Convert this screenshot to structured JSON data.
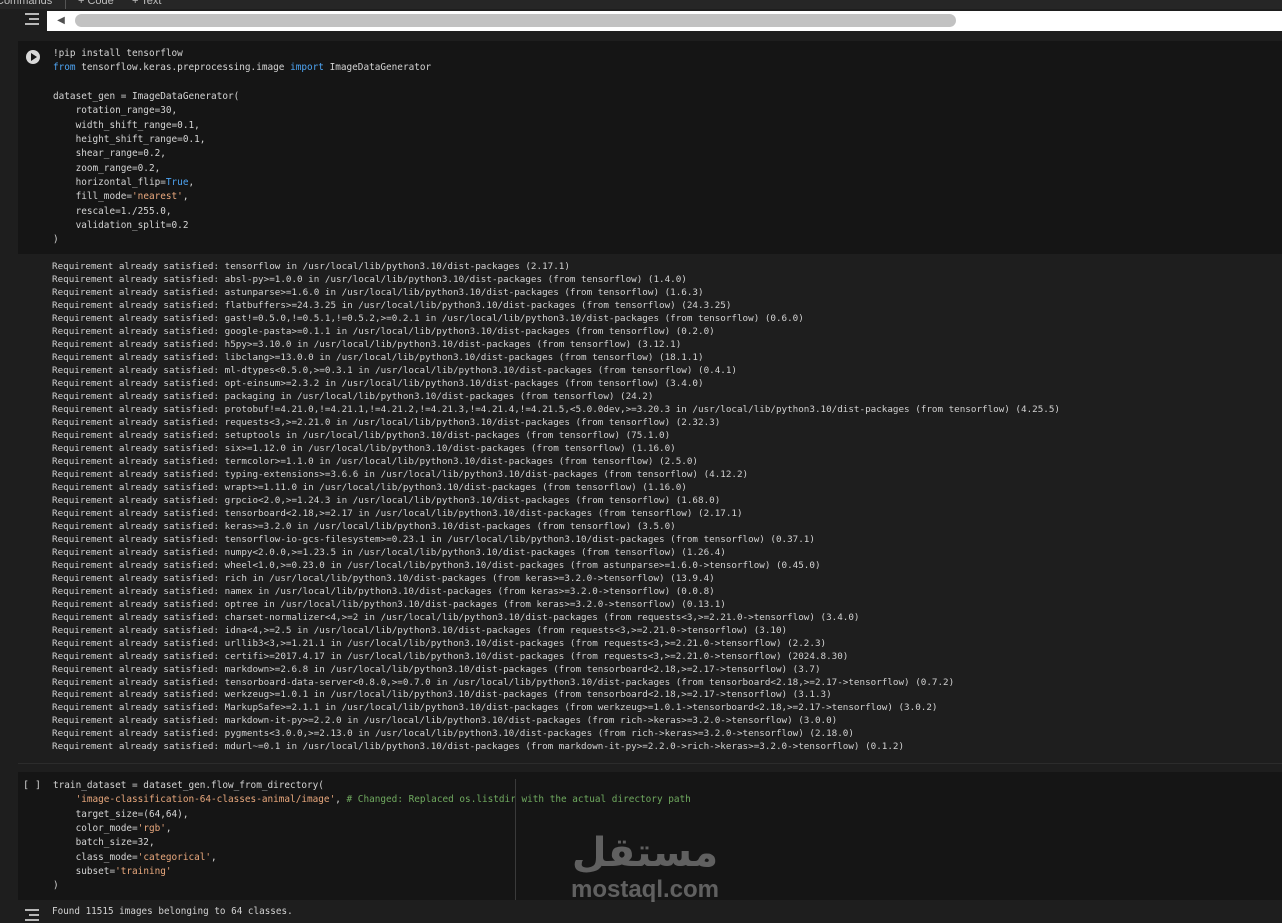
{
  "toolbar": {
    "commands_label": "Commands",
    "add_code_label": "+ Code",
    "add_text_label": "+ Text"
  },
  "cells": [
    {
      "execution_count": "",
      "code_lines": [
        [
          {
            "t": "!pip install tensorflow"
          }
        ],
        [
          {
            "t": "from",
            "c": "kw"
          },
          {
            "t": " tensorflow.keras.preprocessing.image "
          },
          {
            "t": "import",
            "c": "kw"
          },
          {
            "t": " ImageDataGenerator"
          }
        ],
        [
          {
            "t": ""
          }
        ],
        [
          {
            "t": "dataset_gen = ImageDataGenerator("
          }
        ],
        [
          {
            "t": "    rotation_range=30,"
          }
        ],
        [
          {
            "t": "    width_shift_range=0.1,"
          }
        ],
        [
          {
            "t": "    height_shift_range=0.1,"
          }
        ],
        [
          {
            "t": "    shear_range=0.2,"
          }
        ],
        [
          {
            "t": "    zoom_range=0.2,"
          }
        ],
        [
          {
            "t": "    horizontal_flip="
          },
          {
            "t": "True",
            "c": "kw"
          },
          {
            "t": ","
          }
        ],
        [
          {
            "t": "    fill_mode="
          },
          {
            "t": "'nearest'",
            "c": "str"
          },
          {
            "t": ","
          }
        ],
        [
          {
            "t": "    rescale=1./255.0,"
          }
        ],
        [
          {
            "t": "    validation_split=0.2"
          }
        ],
        [
          {
            "t": ")"
          }
        ]
      ],
      "output_lines": [
        "Requirement already satisfied: tensorflow in /usr/local/lib/python3.10/dist-packages (2.17.1)",
        "Requirement already satisfied: absl-py>=1.0.0 in /usr/local/lib/python3.10/dist-packages (from tensorflow) (1.4.0)",
        "Requirement already satisfied: astunparse>=1.6.0 in /usr/local/lib/python3.10/dist-packages (from tensorflow) (1.6.3)",
        "Requirement already satisfied: flatbuffers>=24.3.25 in /usr/local/lib/python3.10/dist-packages (from tensorflow) (24.3.25)",
        "Requirement already satisfied: gast!=0.5.0,!=0.5.1,!=0.5.2,>=0.2.1 in /usr/local/lib/python3.10/dist-packages (from tensorflow) (0.6.0)",
        "Requirement already satisfied: google-pasta>=0.1.1 in /usr/local/lib/python3.10/dist-packages (from tensorflow) (0.2.0)",
        "Requirement already satisfied: h5py>=3.10.0 in /usr/local/lib/python3.10/dist-packages (from tensorflow) (3.12.1)",
        "Requirement already satisfied: libclang>=13.0.0 in /usr/local/lib/python3.10/dist-packages (from tensorflow) (18.1.1)",
        "Requirement already satisfied: ml-dtypes<0.5.0,>=0.3.1 in /usr/local/lib/python3.10/dist-packages (from tensorflow) (0.4.1)",
        "Requirement already satisfied: opt-einsum>=2.3.2 in /usr/local/lib/python3.10/dist-packages (from tensorflow) (3.4.0)",
        "Requirement already satisfied: packaging in /usr/local/lib/python3.10/dist-packages (from tensorflow) (24.2)",
        "Requirement already satisfied: protobuf!=4.21.0,!=4.21.1,!=4.21.2,!=4.21.3,!=4.21.4,!=4.21.5,<5.0.0dev,>=3.20.3 in /usr/local/lib/python3.10/dist-packages (from tensorflow) (4.25.5)",
        "Requirement already satisfied: requests<3,>=2.21.0 in /usr/local/lib/python3.10/dist-packages (from tensorflow) (2.32.3)",
        "Requirement already satisfied: setuptools in /usr/local/lib/python3.10/dist-packages (from tensorflow) (75.1.0)",
        "Requirement already satisfied: six>=1.12.0 in /usr/local/lib/python3.10/dist-packages (from tensorflow) (1.16.0)",
        "Requirement already satisfied: termcolor>=1.1.0 in /usr/local/lib/python3.10/dist-packages (from tensorflow) (2.5.0)",
        "Requirement already satisfied: typing-extensions>=3.6.6 in /usr/local/lib/python3.10/dist-packages (from tensorflow) (4.12.2)",
        "Requirement already satisfied: wrapt>=1.11.0 in /usr/local/lib/python3.10/dist-packages (from tensorflow) (1.16.0)",
        "Requirement already satisfied: grpcio<2.0,>=1.24.3 in /usr/local/lib/python3.10/dist-packages (from tensorflow) (1.68.0)",
        "Requirement already satisfied: tensorboard<2.18,>=2.17 in /usr/local/lib/python3.10/dist-packages (from tensorflow) (2.17.1)",
        "Requirement already satisfied: keras>=3.2.0 in /usr/local/lib/python3.10/dist-packages (from tensorflow) (3.5.0)",
        "Requirement already satisfied: tensorflow-io-gcs-filesystem>=0.23.1 in /usr/local/lib/python3.10/dist-packages (from tensorflow) (0.37.1)",
        "Requirement already satisfied: numpy<2.0.0,>=1.23.5 in /usr/local/lib/python3.10/dist-packages (from tensorflow) (1.26.4)",
        "Requirement already satisfied: wheel<1.0,>=0.23.0 in /usr/local/lib/python3.10/dist-packages (from astunparse>=1.6.0->tensorflow) (0.45.0)",
        "Requirement already satisfied: rich in /usr/local/lib/python3.10/dist-packages (from keras>=3.2.0->tensorflow) (13.9.4)",
        "Requirement already satisfied: namex in /usr/local/lib/python3.10/dist-packages (from keras>=3.2.0->tensorflow) (0.0.8)",
        "Requirement already satisfied: optree in /usr/local/lib/python3.10/dist-packages (from keras>=3.2.0->tensorflow) (0.13.1)",
        "Requirement already satisfied: charset-normalizer<4,>=2 in /usr/local/lib/python3.10/dist-packages (from requests<3,>=2.21.0->tensorflow) (3.4.0)",
        "Requirement already satisfied: idna<4,>=2.5 in /usr/local/lib/python3.10/dist-packages (from requests<3,>=2.21.0->tensorflow) (3.10)",
        "Requirement already satisfied: urllib3<3,>=1.21.1 in /usr/local/lib/python3.10/dist-packages (from requests<3,>=2.21.0->tensorflow) (2.2.3)",
        "Requirement already satisfied: certifi>=2017.4.17 in /usr/local/lib/python3.10/dist-packages (from requests<3,>=2.21.0->tensorflow) (2024.8.30)",
        "Requirement already satisfied: markdown>=2.6.8 in /usr/local/lib/python3.10/dist-packages (from tensorboard<2.18,>=2.17->tensorflow) (3.7)",
        "Requirement already satisfied: tensorboard-data-server<0.8.0,>=0.7.0 in /usr/local/lib/python3.10/dist-packages (from tensorboard<2.18,>=2.17->tensorflow) (0.7.2)",
        "Requirement already satisfied: werkzeug>=1.0.1 in /usr/local/lib/python3.10/dist-packages (from tensorboard<2.18,>=2.17->tensorflow) (3.1.3)",
        "Requirement already satisfied: MarkupSafe>=2.1.1 in /usr/local/lib/python3.10/dist-packages (from werkzeug>=1.0.1->tensorboard<2.18,>=2.17->tensorflow) (3.0.2)",
        "Requirement already satisfied: markdown-it-py>=2.2.0 in /usr/local/lib/python3.10/dist-packages (from rich->keras>=3.2.0->tensorflow) (3.0.0)",
        "Requirement already satisfied: pygments<3.0.0,>=2.13.0 in /usr/local/lib/python3.10/dist-packages (from rich->keras>=3.2.0->tensorflow) (2.18.0)",
        "Requirement already satisfied: mdurl~=0.1 in /usr/local/lib/python3.10/dist-packages (from markdown-it-py>=2.2.0->rich->keras>=3.2.0->tensorflow) (0.1.2)"
      ]
    },
    {
      "execution_count": "[ ]",
      "code_lines": [
        [
          {
            "t": "train_dataset = dataset_gen.flow_from_directory("
          }
        ],
        [
          {
            "t": "    "
          },
          {
            "t": "'image-classification-64-classes-animal/image'",
            "c": "str"
          },
          {
            "t": ", "
          },
          {
            "t": "# Changed: Replaced os.listdir with the actual directory path",
            "c": "com"
          }
        ],
        [
          {
            "t": "    target_size=(64,64),"
          }
        ],
        [
          {
            "t": "    color_mode="
          },
          {
            "t": "'rgb'",
            "c": "str"
          },
          {
            "t": ","
          }
        ],
        [
          {
            "t": "    batch_size=32,"
          }
        ],
        [
          {
            "t": "    class_mode="
          },
          {
            "t": "'categorical'",
            "c": "str"
          },
          {
            "t": ","
          }
        ],
        [
          {
            "t": "    subset="
          },
          {
            "t": "'training'",
            "c": "str"
          },
          {
            "t": ""
          }
        ],
        [
          {
            "t": ")"
          }
        ]
      ],
      "output_lines": [
        "Found 11515 images belonging to 64 classes."
      ]
    }
  ],
  "watermark": {
    "arabic_text": "مستقل",
    "latin_text": "mostaql.com"
  },
  "icons": {
    "run": "play-icon",
    "output_toggle": "output-toggle-icon",
    "scroll_left": "chevron-left-icon"
  },
  "colors": {
    "background": "#1e1e1e",
    "cell_background": "#151515",
    "keyword": "#4ea4f2",
    "string": "#e9a87d",
    "comment": "#6fa95f"
  }
}
